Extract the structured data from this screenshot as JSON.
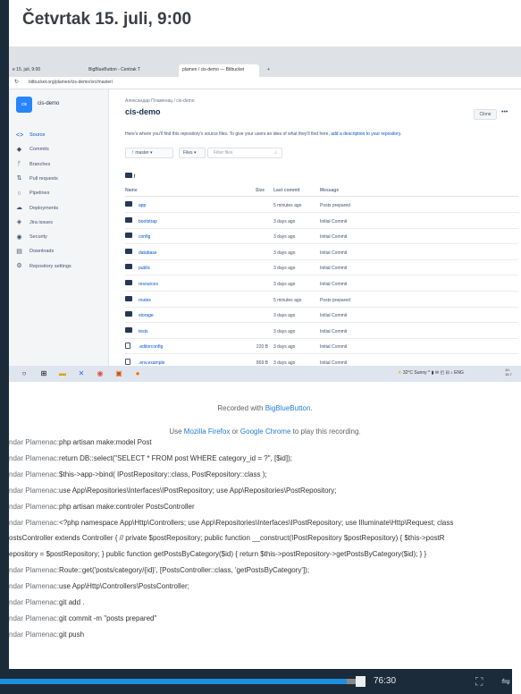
{
  "header": {
    "title": "Četvrtak 15. juli, 9:00"
  },
  "browser": {
    "tabs": [
      {
        "label": "e 15. juli, 9:00",
        "active": false
      },
      {
        "label": "BigBlueButton - Centrak T",
        "active": false
      },
      {
        "label": "plamen / cis-demo — Bitbucket",
        "active": true
      }
    ],
    "new_tab_label": "+",
    "address": "bitbucket.org/plamen/cis-demo/src/master/"
  },
  "bitbucket": {
    "repo_logo": "cis",
    "repo_name": "cis-demo",
    "nav": [
      {
        "label": "Source",
        "icon": "<>",
        "active": true
      },
      {
        "label": "Commits",
        "icon": "◆",
        "active": false
      },
      {
        "label": "Branches",
        "icon": "ᚠ",
        "active": false
      },
      {
        "label": "Pull requests",
        "icon": "⇅",
        "active": false
      },
      {
        "label": "Pipelines",
        "icon": "○",
        "active": false
      },
      {
        "label": "Deployments",
        "icon": "☁",
        "active": false
      },
      {
        "label": "Jira issues",
        "icon": "◈",
        "active": false
      },
      {
        "label": "Security",
        "icon": "◉",
        "active": false
      },
      {
        "label": "Downloads",
        "icon": "▤",
        "active": false
      },
      {
        "label": "Repository settings",
        "icon": "⚙",
        "active": false
      }
    ],
    "breadcrumb": "Александар Пламенац / cis-demo",
    "title": "cis-demo",
    "clone_label": "Clone",
    "more_label": "•••",
    "hint_text": "Here's where you'll find this repository's source files. To give your users an idea of what they'll find here,",
    "hint_link": "add a description to your repository.",
    "branch_label": "master",
    "files_label": "Files",
    "filter_placeholder": "Filter files",
    "root_label": "/",
    "columns": {
      "name": "Name",
      "size": "Size",
      "last_commit": "Last commit",
      "message": "Message"
    },
    "rows": [
      {
        "type": "folder",
        "name": "app",
        "size": "",
        "date": "5 minutes ago",
        "message": "Posts prepared"
      },
      {
        "type": "folder",
        "name": "bootstrap",
        "size": "",
        "date": "3 days ago",
        "message": "Initial Commit"
      },
      {
        "type": "folder",
        "name": "config",
        "size": "",
        "date": "3 days ago",
        "message": "Initial Commit"
      },
      {
        "type": "folder",
        "name": "database",
        "size": "",
        "date": "3 days ago",
        "message": "Initial Commit"
      },
      {
        "type": "folder",
        "name": "public",
        "size": "",
        "date": "3 days ago",
        "message": "Initial Commit"
      },
      {
        "type": "folder",
        "name": "resources",
        "size": "",
        "date": "3 days ago",
        "message": "Initial Commit"
      },
      {
        "type": "folder",
        "name": "routes",
        "size": "",
        "date": "5 minutes ago",
        "message": "Posts prepared"
      },
      {
        "type": "folder",
        "name": "storage",
        "size": "",
        "date": "3 days ago",
        "message": "Initial Commit"
      },
      {
        "type": "folder",
        "name": "tests",
        "size": "",
        "date": "3 days ago",
        "message": "Initial Commit"
      },
      {
        "type": "file",
        "name": ".editorconfig",
        "size": "220 B",
        "date": "3 days ago",
        "message": "Initial Commit"
      },
      {
        "type": "file",
        "name": ".env.example",
        "size": "869 B",
        "date": "3 days ago",
        "message": "Initial Commit"
      }
    ]
  },
  "taskbar": {
    "tray_text": "32°C Sunny",
    "tray_lang": "ENG",
    "clock": "10:\n15.7"
  },
  "recorded": {
    "prefix": "Recorded with ",
    "link": "BigBlueButton",
    "suffix": "."
  },
  "use_note": {
    "prefix": "Use ",
    "link1": "Mozilla Firefox",
    "middle": " or ",
    "link2": "Google Chrome",
    "suffix": " to play this recording."
  },
  "chat": [
    {
      "author": "ndar Plamenac:",
      "text": "php artisan make:model Post"
    },
    {
      "author": "ndar Plamenac:",
      "text": "return DB::select(\"SELECT * FROM post WHERE category_id = ?\", [$id]);"
    },
    {
      "author": "ndar Plamenac:",
      "text": "$this->app->bind( IPostRepository::class, PostRepository::class );"
    },
    {
      "author": "ndar Plamenac:",
      "text": "use App\\Repositories\\Interfaces\\IPostRepository; use App\\Repositories\\PostRepository;"
    },
    {
      "author": "ndar Plamenac:",
      "text": "php artisan make:controler PostsController"
    },
    {
      "author": "ndar Plamenac:",
      "text": "<?php namespace App\\Http\\Controllers; use App\\Repositories\\Interfaces\\IPostRepository; use Illuminate\\Http\\Request; class"
    },
    {
      "author": "",
      "text": "ostsController extends Controller { // private $postRepository; public function __construct(IPostRepository $postRepository) { $this->postR"
    },
    {
      "author": "",
      "text": "epository = $postRepository; } public function getPostsByCategory($id) { return $this->postRepository->getPostsByCategory($id); } }"
    },
    {
      "author": "ndar Plamenac:",
      "text": "Route::get('posts/category/{id}', [PostsController::class, 'getPostsByCategory']);"
    },
    {
      "author": "ndar Plamenac:",
      "text": "use App\\Http\\Controllers\\PostsController;"
    },
    {
      "author": "ndar Plamenac:",
      "text": "git add ."
    },
    {
      "author": "ndar Plamenac:",
      "text": "git commit -m \"posts prepared\""
    },
    {
      "author": "ndar Plamenac:",
      "text": "git push"
    }
  ],
  "player": {
    "time": "76:30",
    "progress": 0.97,
    "fullscreen_icon": "⛶",
    "settings_icon": "⇋"
  },
  "colors": {
    "accent": "#1e8fe0",
    "background": "#1c2b3a",
    "bitbucket_blue": "#0052cc"
  }
}
